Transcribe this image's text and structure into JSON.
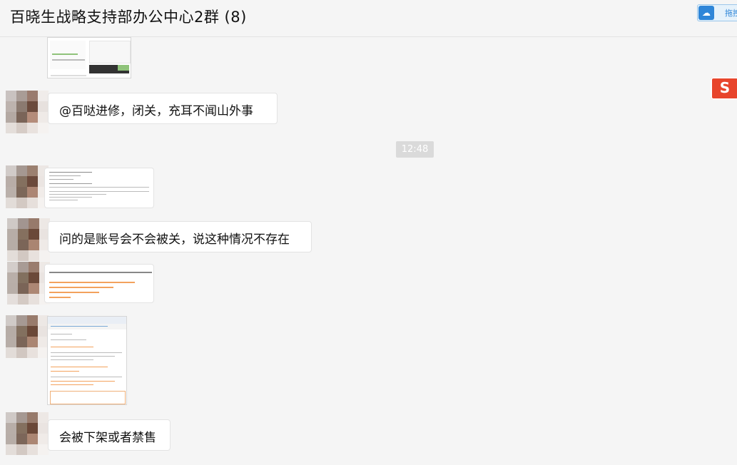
{
  "window": {
    "title": "百晓生战略支持部办公中心2群 (8)",
    "toolbar_button_label": "拖拽"
  },
  "messages": [
    {
      "type": "image",
      "thumb": "screenshot-thumb"
    },
    {
      "type": "text",
      "text": "@百哒进修，闭关，充耳不闻山外事"
    },
    {
      "type": "timestamp",
      "text": "12:48"
    },
    {
      "type": "image",
      "thumb": "email-screenshot-thumb"
    },
    {
      "type": "text",
      "text": "问的是账号会不会被关，说这种情况不存在"
    },
    {
      "type": "image",
      "thumb": "text-screenshot-thumb"
    },
    {
      "type": "image",
      "thumb": "browser-screenshot-thumb"
    },
    {
      "type": "text",
      "text": "会被下架或者禁售"
    }
  ],
  "icons": {
    "toolbar": "cloud-share-icon",
    "ime": "sogou-ime-icon"
  },
  "colors": {
    "bg": "#f5f5f5",
    "accent": "#2f86d8",
    "orange": "#f3a25d",
    "ime": "#e8452c"
  }
}
